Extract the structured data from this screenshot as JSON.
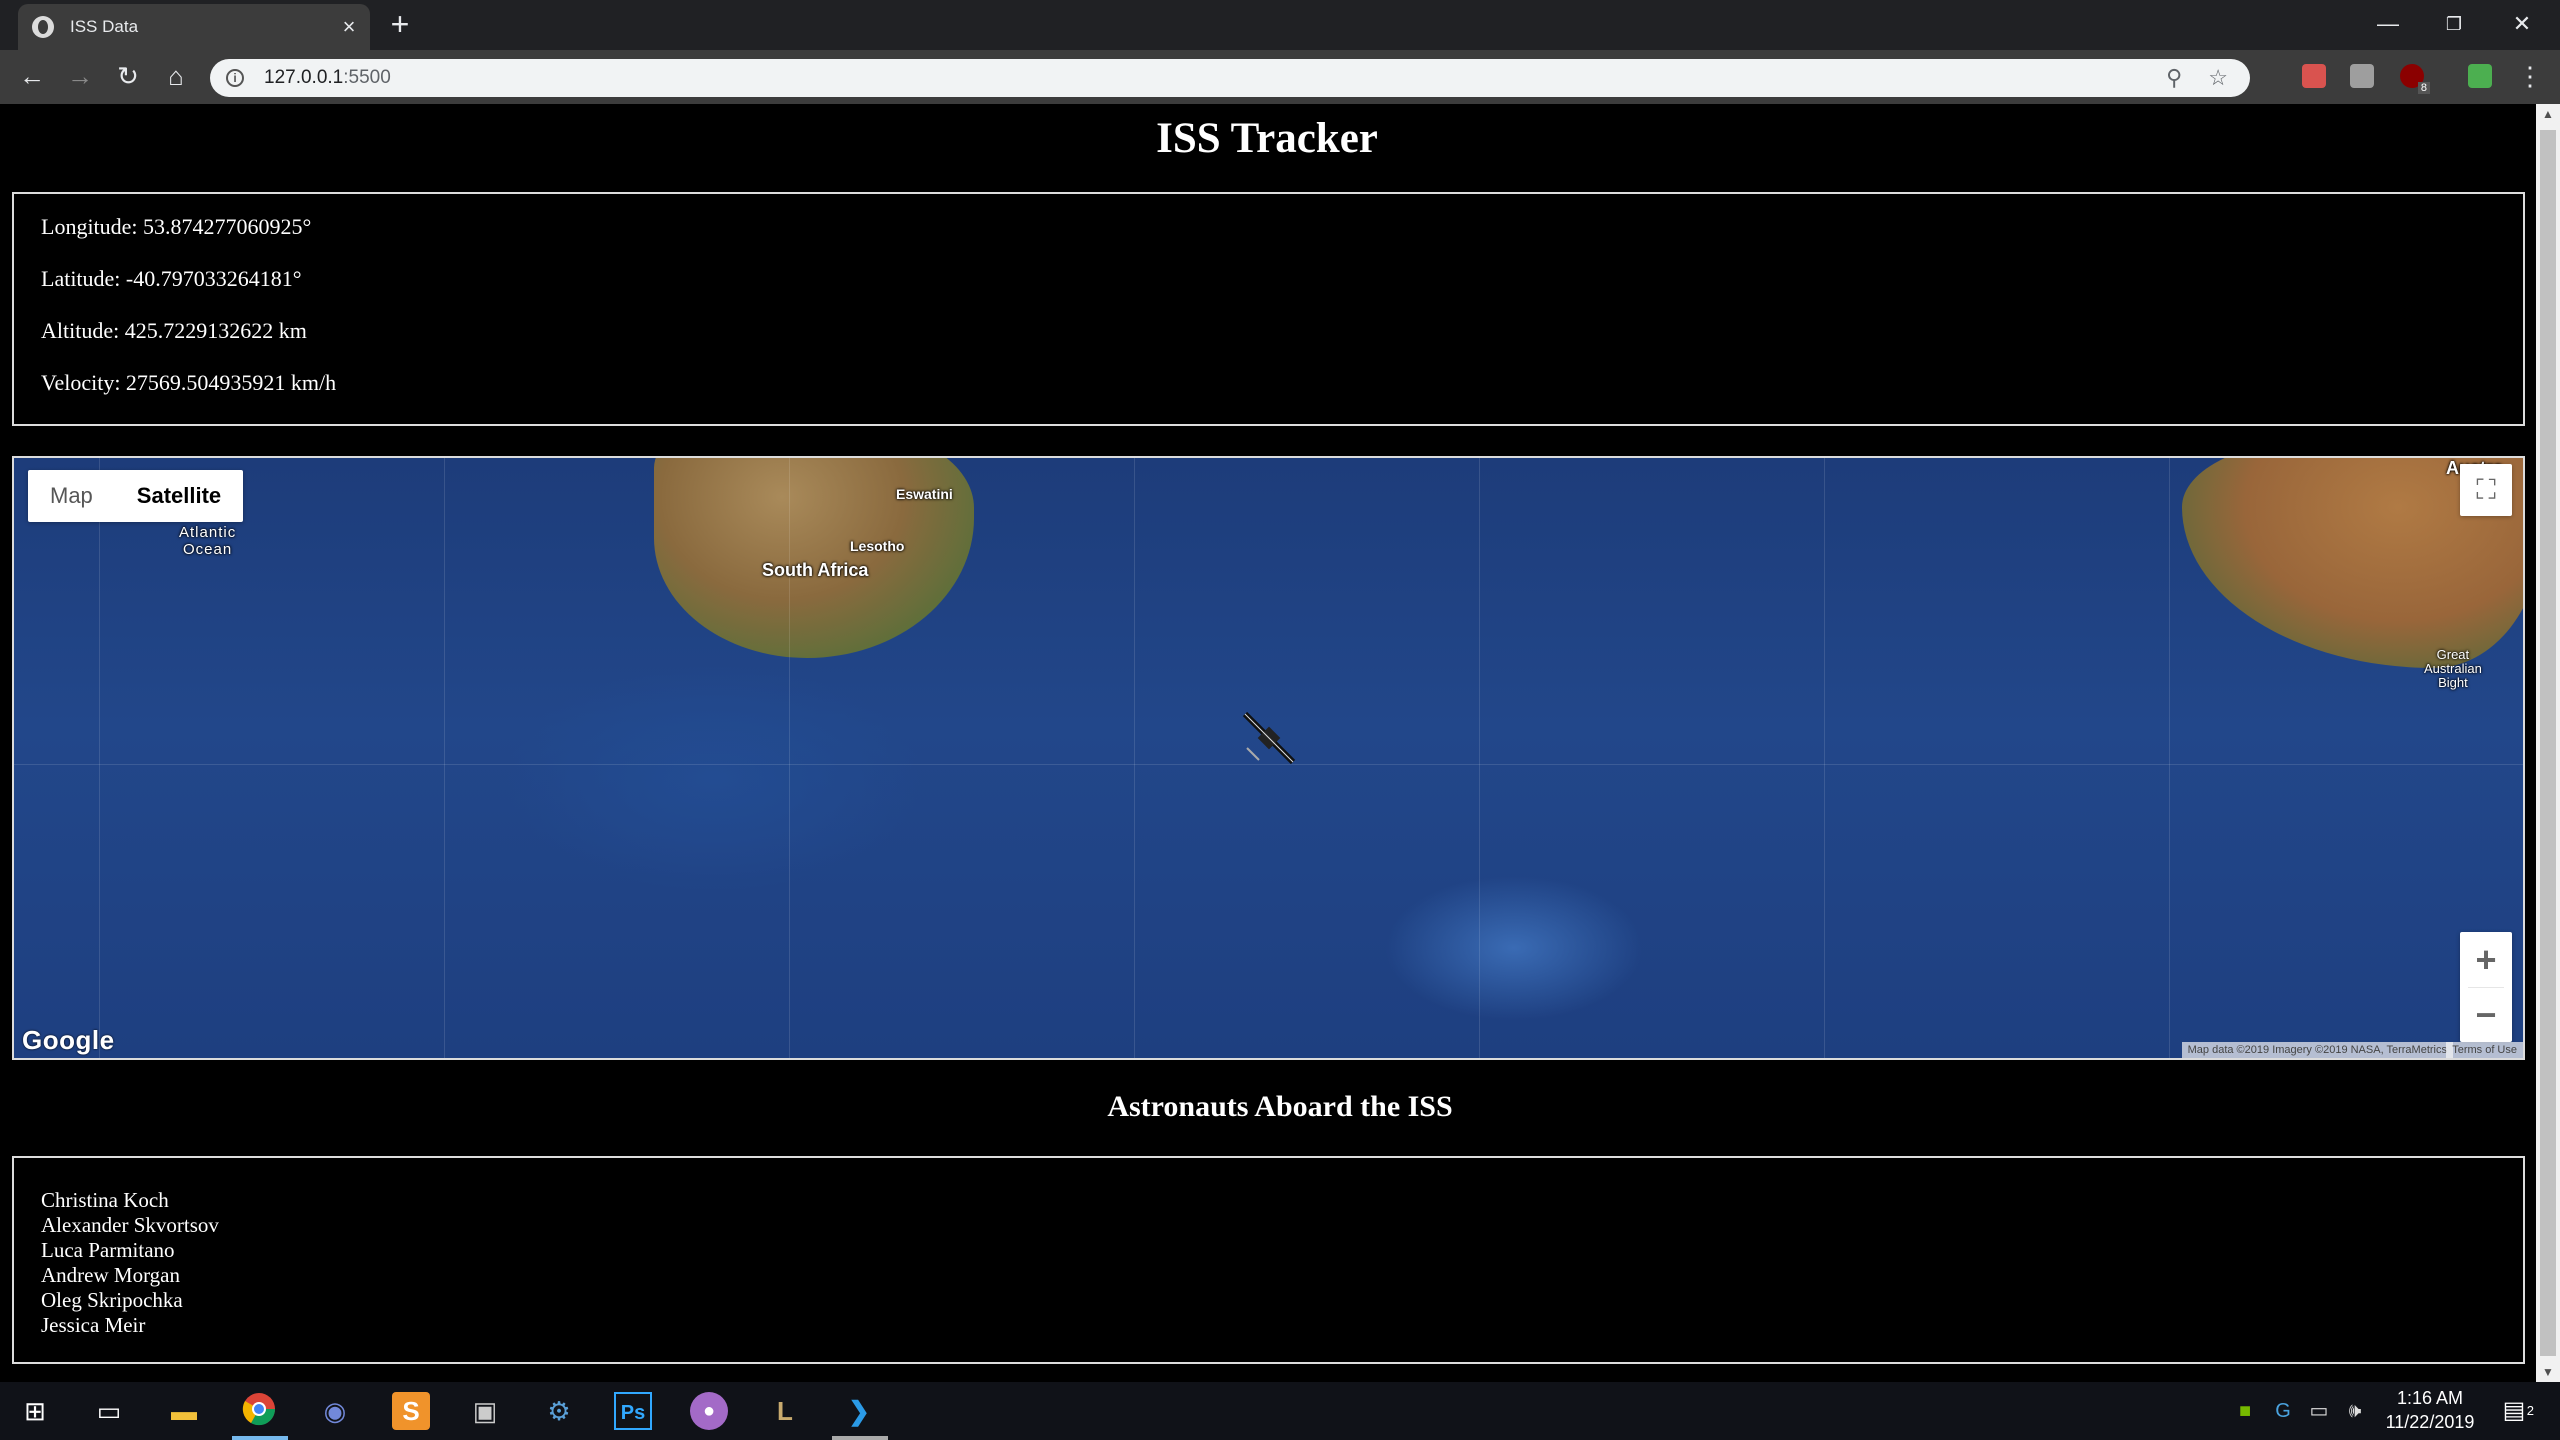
{
  "browser": {
    "tab_title": "ISS Data",
    "url_host": "127.0.0.1",
    "url_port": ":5500"
  },
  "page": {
    "title": "ISS Tracker",
    "longitude": "Longitude: 53.874277060925°",
    "latitude": "Latitude: -40.797033264181°",
    "altitude": "Altitude: 425.7229132622 km",
    "velocity": "Velocity: 27569.504935921 km/h"
  },
  "map": {
    "type_map": "Map",
    "type_satellite": "Satellite",
    "labels": {
      "atlantic_1": "Atlantic",
      "atlantic_2": "Ocean",
      "eswatini": "Eswatini",
      "lesotho": "Lesotho",
      "south_africa": "South Africa",
      "australia_partial": "Austra",
      "bight_1": "Great",
      "bight_2": "Australian",
      "bight_3": "Bight"
    },
    "google_logo": "Google",
    "attribution": "Map data ©2019 Imagery ©2019 NASA, TerraMetrics",
    "terms": "Terms of Use",
    "zoom_in": "+",
    "zoom_out": "−"
  },
  "astronauts": {
    "heading": "Astronauts Aboard the ISS",
    "names": [
      "Christina Koch",
      "Alexander Skvortsov",
      "Luca Parmitano",
      "Andrew Morgan",
      "Oleg Skripochka",
      "Jessica Meir"
    ]
  },
  "taskbar": {
    "time": "1:16 AM",
    "date": "11/22/2019",
    "notification_count": "2"
  },
  "extensions": {
    "ublock_badge": "8"
  }
}
